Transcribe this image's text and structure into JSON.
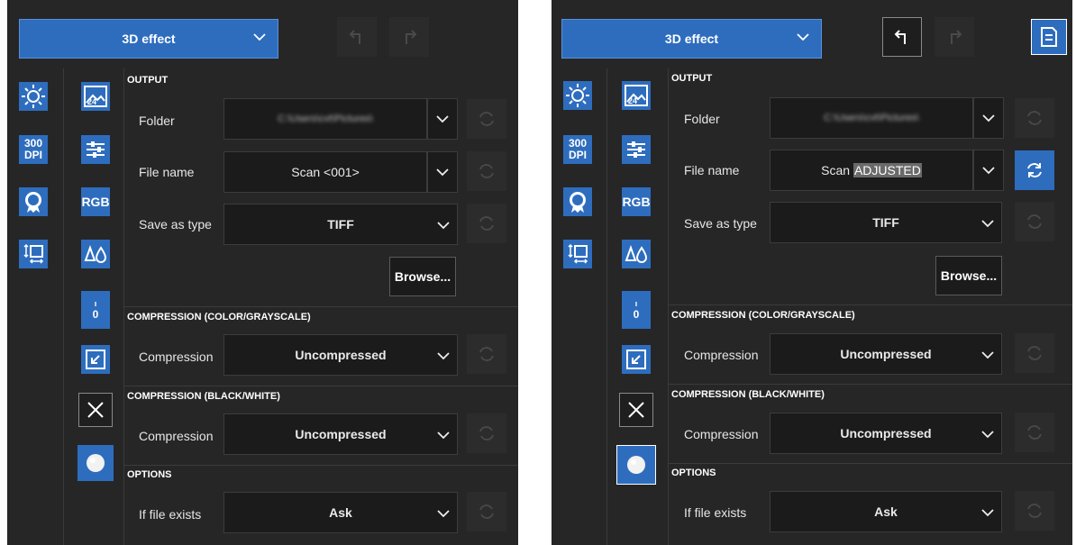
{
  "left": {
    "preset_label": "3D effect",
    "sidebar_a": [
      "sun-icon",
      "dpi-badge",
      "off-badge-icon",
      "fit-frame-icon"
    ],
    "dpi_line1": "300",
    "dpi_line2": "DPI",
    "sidebar_b_rgb": "RGB",
    "sidebar_b_zero": "0",
    "output_title": "OUTPUT",
    "folder_label": "Folder",
    "folder_value": "C:\\Users\\cvt\\Pictures\\",
    "filename_label": "File name",
    "filename_value": "Scan <001>",
    "savetype_label": "Save as type",
    "savetype_value": "TIFF",
    "browse_label": "Browse...",
    "comp_color_title": "COMPRESSION (COLOR/GRAYSCALE)",
    "comp_color_label": "Compression",
    "comp_color_value": "Uncompressed",
    "comp_bw_title": "COMPRESSION (BLACK/WHITE)",
    "comp_bw_label": "Compression",
    "comp_bw_value": "Uncompressed",
    "options_title": "OPTIONS",
    "iffile_label": "If file exists",
    "iffile_value": "Ask"
  },
  "right": {
    "preset_label": "3D effect",
    "dpi_line1": "300",
    "dpi_line2": "DPI",
    "sidebar_b_rgb": "RGB",
    "sidebar_b_zero": "0",
    "output_title": "OUTPUT",
    "folder_label": "Folder",
    "folder_value": "C:\\Users\\cvt\\Pictures\\",
    "filename_label": "File name",
    "filename_prefix": "Scan ",
    "filename_highlight": "ADJUSTED",
    "savetype_label": "Save as type",
    "savetype_value": "TIFF",
    "browse_label": "Browse...",
    "comp_color_title": "COMPRESSION (COLOR/GRAYSCALE)",
    "comp_color_label": "Compression",
    "comp_color_value": "Uncompressed",
    "comp_bw_title": "COMPRESSION (BLACK/WHITE)",
    "comp_bw_label": "Compression",
    "comp_bw_value": "Uncompressed",
    "options_title": "OPTIONS",
    "iffile_label": "If file exists",
    "iffile_value": "Ask"
  },
  "colors": {
    "accent": "#2e6dbe",
    "panel": "#262626",
    "field": "#1b1b1b"
  }
}
